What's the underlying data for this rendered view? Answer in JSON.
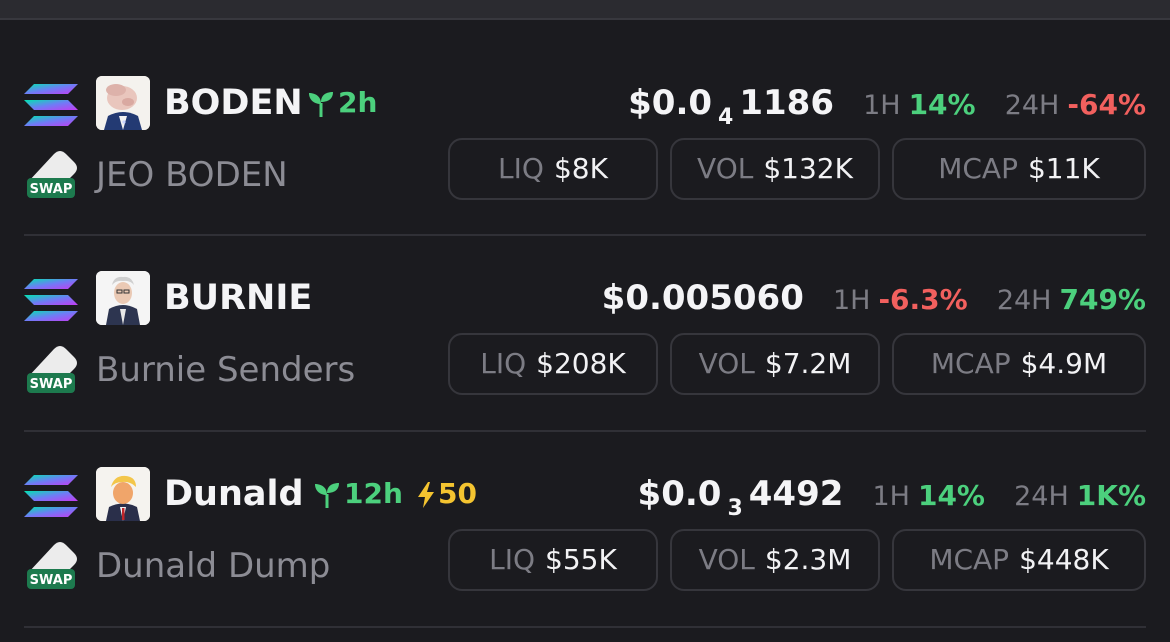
{
  "tokens": [
    {
      "symbol": "BODEN",
      "age": "2h",
      "price_prefix": "$0.0",
      "price_zeros": "4",
      "price_tail": "1186",
      "h1_label": "1H",
      "h1_change": "14%",
      "h24_label": "24H",
      "h24_change": "-64%",
      "name": "JEO BODEN",
      "liq_label": "LIQ",
      "liq": "$8K",
      "vol_label": "VOL",
      "vol": "$132K",
      "mcap_label": "MCAP",
      "mcap": "$11K"
    },
    {
      "symbol": "BURNIE",
      "price": "$0.005060",
      "h1_label": "1H",
      "h1_change": "-6.3%",
      "h24_label": "24H",
      "h24_change": "749%",
      "name": "Burnie Senders",
      "liq_label": "LIQ",
      "liq": "$208K",
      "vol_label": "VOL",
      "vol": "$7.2M",
      "mcap_label": "MCAP",
      "mcap": "$4.9M"
    },
    {
      "symbol": "Dunald",
      "age": "12h",
      "boost": "50",
      "price_prefix": "$0.0",
      "price_zeros": "3",
      "price_tail": "4492",
      "h1_label": "1H",
      "h1_change": "14%",
      "h24_label": "24H",
      "h24_change": "1K%",
      "name": "Dunald Dump",
      "liq_label": "LIQ",
      "liq": "$55K",
      "vol_label": "VOL",
      "vol": "$2.3M",
      "mcap_label": "MCAP",
      "mcap": "$448K"
    }
  ],
  "icons": {
    "chain": "solana-icon",
    "swap_label": "SWAP",
    "age": "seedling-icon",
    "boost": "lightning-icon"
  },
  "colors": {
    "background": "#1b1b1f",
    "positive": "#4cd07d",
    "negative": "#f2605e",
    "boost": "#f4c430",
    "muted": "#7c7c84"
  }
}
